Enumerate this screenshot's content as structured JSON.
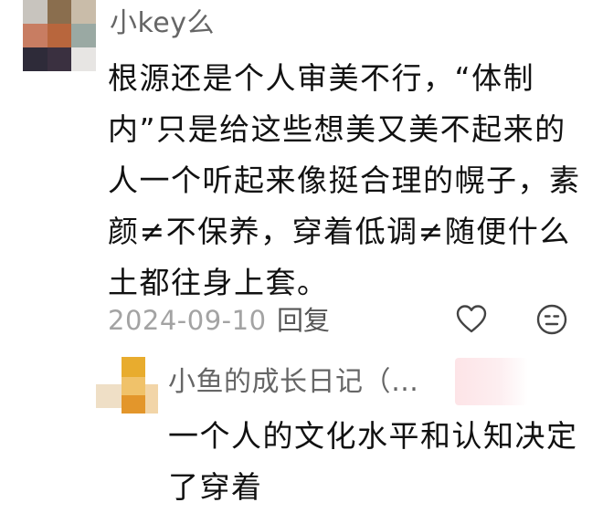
{
  "comment": {
    "username": "小key么",
    "content": "根源还是个人审美不行，“体制内”只是给这些想美又美不起来的人一个听起来像挺合理的幌子，素颜≠不保养，穿着低调≠随便什么土都往身上套。",
    "date": "2024-09-10",
    "reply_label": "回复",
    "avatar_colors": [
      "#c8c4be",
      "#8a6e4e",
      "#c9bca9",
      "#c87d62",
      "#b8663d",
      "#9aa9a3",
      "#2e2b39",
      "#3a3040",
      "#e7e5e3"
    ]
  },
  "reply": {
    "username": "小鱼的成长日记（…",
    "content": "一个人的文化水平和认知决定了穿着",
    "avatar_colors": [
      "#e8ac2e",
      "#f0c26a",
      "#efdfc6",
      "#e3962b"
    ]
  },
  "icons": {
    "like": "heart-outline-icon",
    "emoji": "emoji-face-icon"
  }
}
